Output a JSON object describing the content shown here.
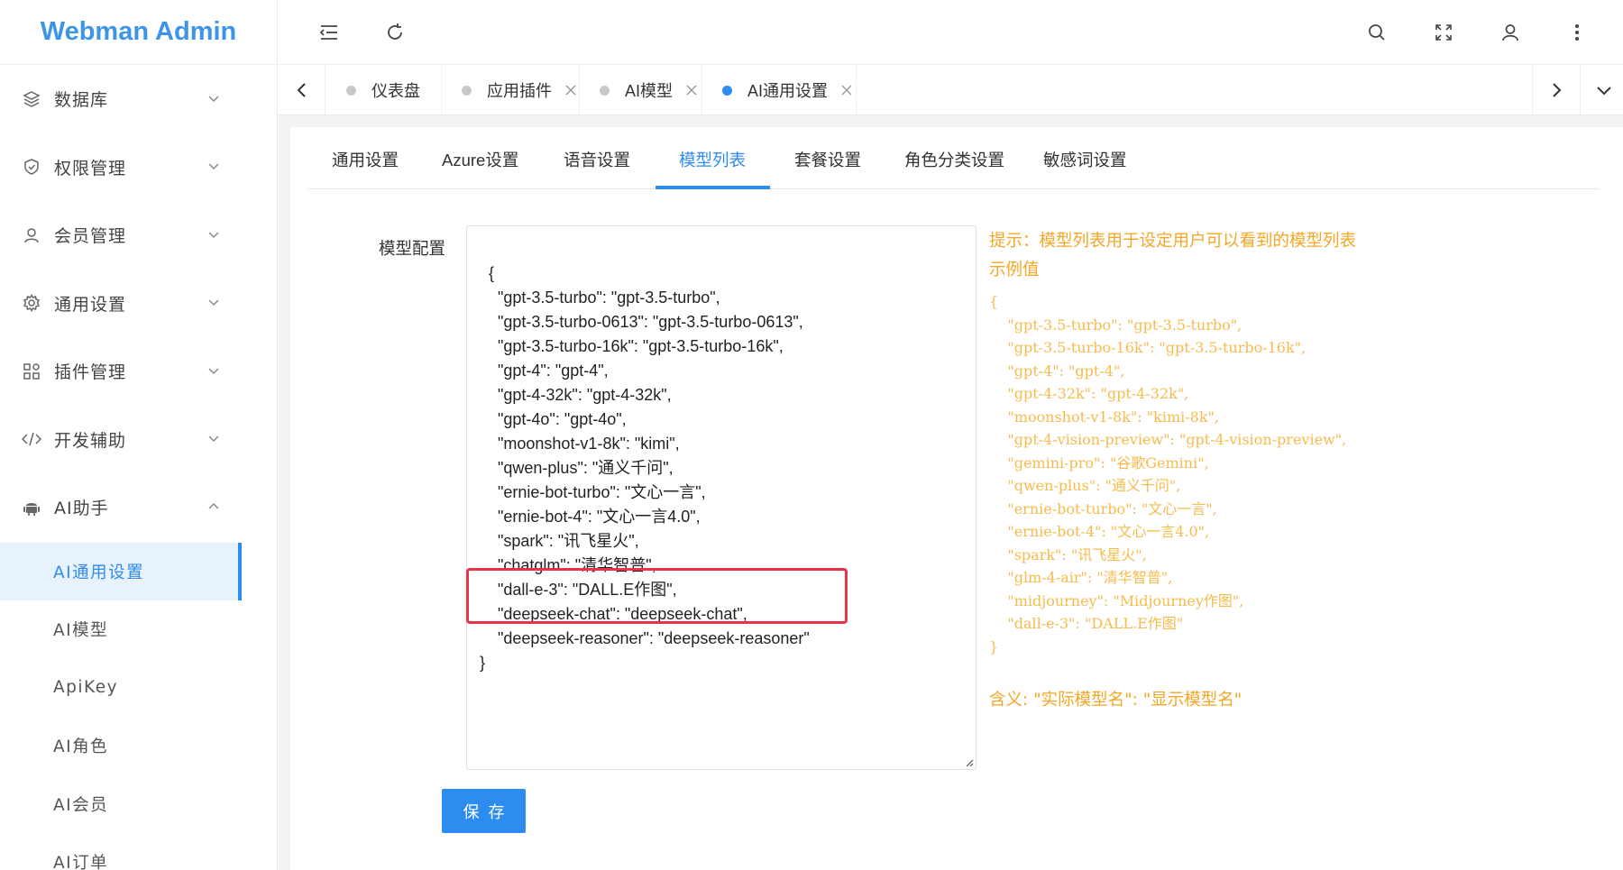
{
  "app": {
    "title": "Webman Admin"
  },
  "sidebar": {
    "groups": [
      {
        "label": "数据库",
        "icon": "layers-icon"
      },
      {
        "label": "权限管理",
        "icon": "shield-icon"
      },
      {
        "label": "会员管理",
        "icon": "user-icon"
      },
      {
        "label": "通用设置",
        "icon": "gear-icon"
      },
      {
        "label": "插件管理",
        "icon": "apps-icon"
      },
      {
        "label": "开发辅助",
        "icon": "code-icon"
      },
      {
        "label": "AI助手",
        "icon": "android-icon"
      }
    ],
    "sub_items": [
      {
        "label": "AI通用设置"
      },
      {
        "label": "AI模型"
      },
      {
        "label": "ApiKey"
      },
      {
        "label": "AI角色"
      },
      {
        "label": "AI会员"
      },
      {
        "label": "AI订单"
      }
    ]
  },
  "tabs": [
    {
      "label": "仪表盘"
    },
    {
      "label": "应用插件"
    },
    {
      "label": "AI模型"
    },
    {
      "label": "AI通用设置"
    }
  ],
  "settings_tabs": [
    {
      "label": "通用设置"
    },
    {
      "label": "Azure设置"
    },
    {
      "label": "语音设置"
    },
    {
      "label": "模型列表"
    },
    {
      "label": "套餐设置"
    },
    {
      "label": "角色分类设置"
    },
    {
      "label": "敏感词设置"
    }
  ],
  "form": {
    "label": "模型配置",
    "value": "{\n    \"gpt-3.5-turbo\": \"gpt-3.5-turbo\",\n    \"gpt-3.5-turbo-0613\": \"gpt-3.5-turbo-0613\",\n    \"gpt-3.5-turbo-16k\": \"gpt-3.5-turbo-16k\",\n    \"gpt-4\": \"gpt-4\",\n    \"gpt-4-32k\": \"gpt-4-32k\",\n    \"gpt-4o\": \"gpt-4o\",\n    \"moonshot-v1-8k\": \"kimi\",\n    \"qwen-plus\": \"通义千问\",\n    \"ernie-bot-turbo\": \"文心一言\",\n    \"ernie-bot-4\": \"文心一言4.0\",\n    \"spark\": \"讯飞星火\",\n    \"chatglm\": \"清华智普\",\n    \"dall-e-3\": \"DALL.E作图\",\n    \"deepseek-chat\": \"deepseek-chat\",\n    \"deepseek-reasoner\": \"deepseek-reasoner\"\n}",
    "save_label": "保存"
  },
  "hint": {
    "title": "提示：模型列表用于设定用户可以看到的模型列表",
    "example_label": "示例值",
    "example_code": "{\n    \"gpt-3.5-turbo\": \"gpt-3.5-turbo\",\n    \"gpt-3.5-turbo-16k\": \"gpt-3.5-turbo-16k\",\n    \"gpt-4\": \"gpt-4\",\n    \"gpt-4-32k\": \"gpt-4-32k\",\n    \"moonshot-v1-8k\": \"kimi-8k\",\n    \"gpt-4-vision-preview\": \"gpt-4-vision-preview\",\n    \"gemini-pro\": \"谷歌Gemini\",\n    \"qwen-plus\": \"通义千问\",\n    \"ernie-bot-turbo\": \"文心一言\",\n    \"ernie-bot-4\": \"文心一言4.0\",\n    \"spark\": \"讯飞星火\",\n    \"glm-4-air\": \"清华智普\",\n    \"midjourney\": \"Midjourney作图\",\n    \"dall-e-3\": \"DALL.E作图\"\n}",
    "meaning": "含义: \"实际模型名\": \"显示模型名\""
  },
  "colors": {
    "accent": "#2d8cf0",
    "hint": "#f5a623",
    "highlight": "#e8334a"
  }
}
